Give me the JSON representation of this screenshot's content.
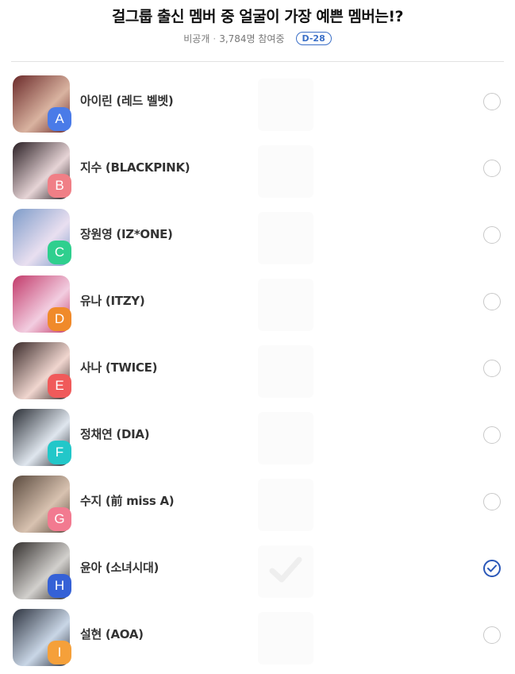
{
  "poll": {
    "title": "걸그룹 출신 멤버 중 얼굴이 가장 예쁜 멤버는!?",
    "visibility": "비공개",
    "participants": "3,784명 참여중",
    "dday": "D-28"
  },
  "options": [
    {
      "letter": "A",
      "name": "아이린 (레드 벨벳)",
      "color": "#4a7be8",
      "selected": false
    },
    {
      "letter": "B",
      "name": "지수 (BLACKPINK)",
      "color": "#f07f86",
      "selected": false
    },
    {
      "letter": "C",
      "name": "장원영 (IZ*ONE)",
      "color": "#2fcf8e",
      "selected": false
    },
    {
      "letter": "D",
      "name": "유나 (ITZY)",
      "color": "#f08a2a",
      "selected": false
    },
    {
      "letter": "E",
      "name": "사나 (TWICE)",
      "color": "#f05a5a",
      "selected": false
    },
    {
      "letter": "F",
      "name": "정채연 (DIA)",
      "color": "#22c7c9",
      "selected": false
    },
    {
      "letter": "G",
      "name": "수지 (前 miss A)",
      "color": "#f27a90",
      "selected": false
    },
    {
      "letter": "H",
      "name": "윤아 (소녀시대)",
      "color": "#3561d6",
      "selected": true
    },
    {
      "letter": "I",
      "name": "설현 (AOA)",
      "color": "#f5a03a",
      "selected": false
    }
  ]
}
